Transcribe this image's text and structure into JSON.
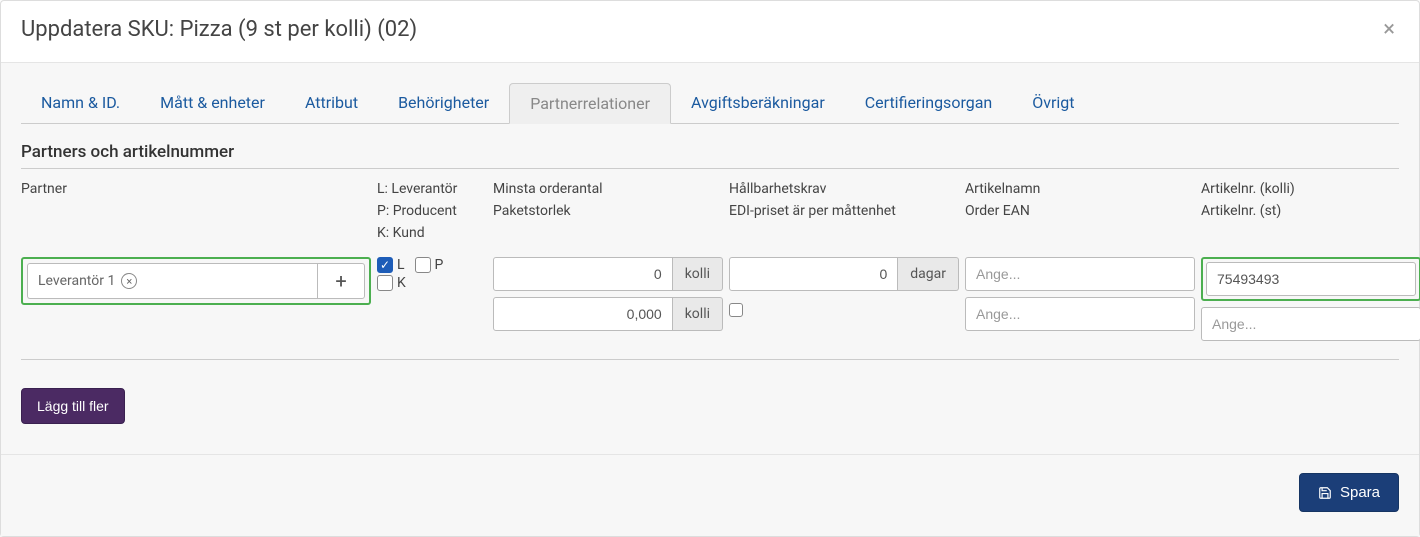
{
  "header": {
    "title": "Uppdatera SKU: Pizza (9 st per kolli) (02)"
  },
  "tabs": [
    {
      "label": "Namn & ID."
    },
    {
      "label": "Mått & enheter"
    },
    {
      "label": "Attribut"
    },
    {
      "label": "Behörigheter"
    },
    {
      "label": "Partnerrelationer",
      "active": true
    },
    {
      "label": "Avgiftsberäkningar"
    },
    {
      "label": "Certifieringsorgan"
    },
    {
      "label": "Övrigt"
    }
  ],
  "section": {
    "title": "Partners och artikelnummer"
  },
  "columns": {
    "partner": "Partner",
    "types": {
      "l": "L: Leverantör",
      "p": "P: Producent",
      "k": "K: Kund"
    },
    "min_order": "Minsta orderantal",
    "pack_size": "Paketstorlek",
    "shelf_req": "Hållbarhetskrav",
    "edi_price": "EDI-priset är per måttenhet",
    "article_name": "Artikelnamn",
    "order_ean": "Order EAN",
    "article_nr_kolli": "Artikelnr. (kolli)",
    "article_nr_st": "Artikelnr. (st)"
  },
  "row": {
    "partner_chip": "Leverantör 1",
    "checks": {
      "l_label": "L",
      "p_label": "P",
      "k_label": "K",
      "l": true,
      "p": false,
      "k": false
    },
    "min_order_value": "0",
    "min_order_unit": "kolli",
    "pack_size_value": "0,000",
    "pack_size_unit": "kolli",
    "shelf_value": "0",
    "shelf_unit": "dagar",
    "placeholder_enter": "Ange...",
    "article_kolli_value": "75493493"
  },
  "buttons": {
    "add_more": "Lägg till fler",
    "save": "Spara"
  }
}
